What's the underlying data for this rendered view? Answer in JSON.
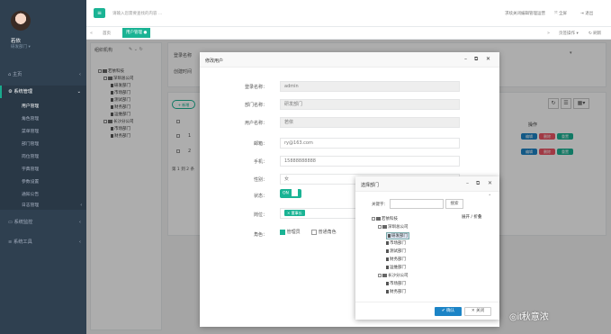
{
  "sidebar": {
    "user_name": "若依",
    "user_dept": "研发部门",
    "home": "主页",
    "system": "系统管理",
    "submenu": [
      "用户管理",
      "角色管理",
      "菜单管理",
      "部门管理",
      "岗位管理",
      "字典管理",
      "参数设置",
      "通知公告",
      "日志管理"
    ],
    "monitor": "系统监控",
    "tools": "系统工具"
  },
  "topbar": {
    "search_placeholder": "请输入您需要查找的内容 ...",
    "right_link": "求续关闭编辑管理运营",
    "fullscreen": "全屏",
    "logout": "退出"
  },
  "tabs": {
    "home": "首页",
    "user": "用户管理",
    "ops": "页签操作",
    "refresh": "刷新"
  },
  "main": {
    "org_title": "组织机构",
    "tree_root": "若依科技",
    "tree_sz": "深圳总公司",
    "tree_sz_children": [
      "研发部门",
      "市场部门",
      "测试部门",
      "财务部门",
      "运维部门"
    ],
    "tree_cs": "长沙分公司",
    "tree_cs_children": [
      "市场部门",
      "财务部门"
    ],
    "filter_label": "登录名称",
    "filter_label2": "创建时间",
    "add_button": "+ 新增",
    "op_col": "操作",
    "rows": [
      "1",
      "2"
    ],
    "pager": "第 1 到 2 条",
    "edit": "编辑",
    "del": "删除",
    "reset": "重置"
  },
  "edit_dialog": {
    "title": "修改用户",
    "fields": {
      "login_label": "登录名称：",
      "login_value": "admin",
      "dept_label": "部门名称：",
      "dept_value": "研发部门",
      "name_label": "用户名称：",
      "name_value": "若依",
      "email_label": "邮箱：",
      "email_value": "ry@163.com",
      "phone_label": "手机：",
      "phone_value": "15888888888",
      "sex_label": "性别：",
      "sex_value": "女",
      "status_label": "状态：",
      "status_value": "ON",
      "post_label": "岗位：",
      "post_value": "× 董事长",
      "role_label": "角色：",
      "role1": "管理员",
      "role2": "普通角色"
    }
  },
  "dept_dialog": {
    "title": "选择部门",
    "keyword_label": "关键字：",
    "search_button": "搜索",
    "expand": "展开 / 折叠",
    "root": "若依科技",
    "sz": "深圳总公司",
    "sz_children": [
      "研发部门",
      "市场部门",
      "测试部门",
      "财务部门",
      "运维部门"
    ],
    "cs": "长沙分公司",
    "cs_children": [
      "市场部门",
      "财务部门"
    ],
    "confirm": "确认",
    "close": "关闭"
  },
  "watermark": "it秋意浓",
  "colors": {
    "sidebar": "#2f4050",
    "accent": "#1ab394",
    "primary": "#1c84c6",
    "danger": "#ed5565"
  }
}
